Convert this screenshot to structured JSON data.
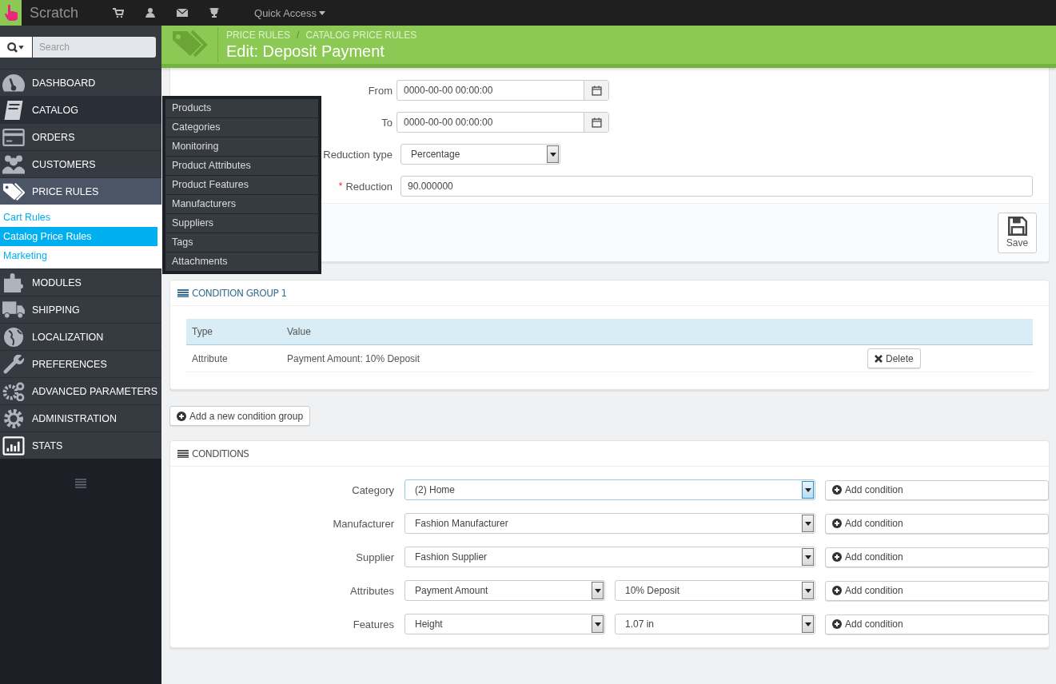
{
  "topbar": {
    "brand": "Scratch",
    "quick_access": "Quick Access"
  },
  "search": {
    "placeholder": "Search"
  },
  "sidebar": {
    "items": [
      {
        "label": "DASHBOARD",
        "selected": false,
        "hovered": false
      },
      {
        "label": "CATALOG",
        "selected": false,
        "hovered": true,
        "flyout": [
          "Products",
          "Categories",
          "Monitoring",
          "Product Attributes",
          "Product Features",
          "Manufacturers",
          "Suppliers",
          "Tags",
          "Attachments"
        ]
      },
      {
        "label": "ORDERS",
        "selected": false,
        "hovered": false
      },
      {
        "label": "CUSTOMERS",
        "selected": false,
        "hovered": false
      },
      {
        "label": "PRICE RULES",
        "selected": true,
        "hovered": false,
        "children": [
          {
            "label": "Cart Rules",
            "selected": false
          },
          {
            "label": "Catalog Price Rules",
            "selected": true
          },
          {
            "label": "Marketing",
            "selected": false
          }
        ]
      },
      {
        "label": "MODULES",
        "selected": false,
        "hovered": false
      },
      {
        "label": "SHIPPING",
        "selected": false,
        "hovered": false
      },
      {
        "label": "LOCALIZATION",
        "selected": false,
        "hovered": false
      },
      {
        "label": "PREFERENCES",
        "selected": false,
        "hovered": false
      },
      {
        "label": "ADVANCED PARAMETERS",
        "selected": false,
        "hovered": false
      },
      {
        "label": "ADMINISTRATION",
        "selected": false,
        "hovered": false
      },
      {
        "label": "STATS",
        "selected": false,
        "hovered": false
      }
    ]
  },
  "header": {
    "breadcrumb": [
      "PRICE RULES",
      "CATALOG PRICE RULES"
    ],
    "separator": "/",
    "title": "Edit: Deposit Payment"
  },
  "form": {
    "required_mark": "*",
    "fields": [
      {
        "kind": "date",
        "label": "From",
        "value": "0000-00-00 00:00:00",
        "required": false
      },
      {
        "kind": "date",
        "label": "To",
        "value": "0000-00-00 00:00:00",
        "required": false
      },
      {
        "kind": "select",
        "label": "Reduction type",
        "value": "Percentage",
        "required": false
      },
      {
        "kind": "text",
        "label": "Reduction",
        "value": "90.000000",
        "required": true
      }
    ],
    "save_button": "Save"
  },
  "condition_group": {
    "title": "CONDITION GROUP 1",
    "columns": [
      "Type",
      "Value"
    ],
    "rows": [
      {
        "type": "Attribute",
        "value": "Payment Amount: 10% Deposit",
        "action": "Delete"
      }
    ]
  },
  "add_group_button": "Add a new condition group",
  "conditions": {
    "title": "CONDITIONS",
    "rows": [
      {
        "label": "Category",
        "selects": [
          {
            "value": "(2) Home",
            "focused": true
          }
        ],
        "button": "Add condition"
      },
      {
        "label": "Manufacturer",
        "selects": [
          {
            "value": "Fashion Manufacturer",
            "focused": false
          }
        ],
        "button": "Add condition"
      },
      {
        "label": "Supplier",
        "selects": [
          {
            "value": "Fashion Supplier",
            "focused": false
          }
        ],
        "button": "Add condition"
      },
      {
        "label": "Attributes",
        "selects": [
          {
            "value": "Payment Amount",
            "focused": false
          },
          {
            "value": "10% Deposit",
            "focused": false
          }
        ],
        "button": "Add condition"
      },
      {
        "label": "Features",
        "selects": [
          {
            "value": "Height",
            "focused": false
          },
          {
            "value": "1.07 in",
            "focused": false
          }
        ],
        "button": "Add condition"
      }
    ]
  }
}
